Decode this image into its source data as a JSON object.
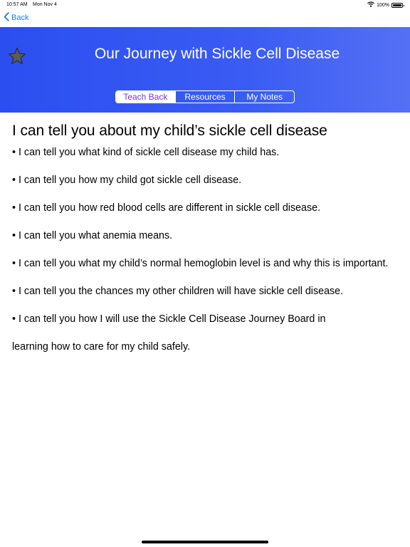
{
  "status_bar": {
    "time": "10:57 AM",
    "date": "Mon Nov 4",
    "battery_text": "100%",
    "battery_level": 1.0
  },
  "nav": {
    "back_label": "Back",
    "accent_color": "#1a7cf5"
  },
  "header": {
    "title": "Our Journey with Sickle Cell Disease",
    "star_icon": "star-icon",
    "tabs": [
      {
        "label": "Teach Back",
        "selected": true
      },
      {
        "label": "Resources",
        "selected": false
      },
      {
        "label": "My Notes",
        "selected": false
      }
    ],
    "selected_tab_color": "#7b2ff0",
    "background_color": "#2b4ef1"
  },
  "content": {
    "heading": "I can tell you about my child’s sickle cell disease",
    "items": [
      "• I can tell you what kind of sickle cell disease my child has.",
      "• I can tell you how my child got sickle cell disease.",
      "• I can tell you how red blood cells are different in sickle cell disease.",
      "• I can tell you what anemia means.",
      "• I can tell you what my child’s normal hemoglobin level is and why this is important.",
      "• I can tell you the chances my other children will have sickle cell disease.",
      "• I can tell you how I will use the Sickle Cell Disease Journey Board in",
      "learning how to care for my child safely."
    ]
  }
}
